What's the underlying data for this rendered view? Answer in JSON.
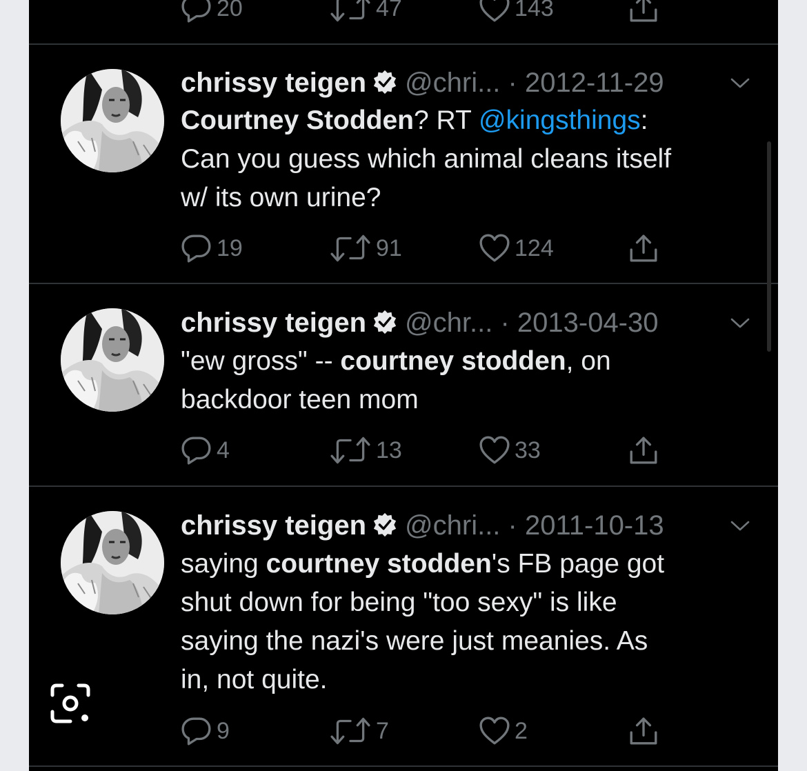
{
  "top_actions": {
    "replies": "20",
    "retweets": "47",
    "likes": "143"
  },
  "tweets": [
    {
      "name": "chrissy teigen",
      "handle": "@chri...",
      "date": "· 2012-11-29",
      "text": {
        "p1": "Courtney Stodden",
        "p2": "? RT ",
        "mention": "@kingsthings",
        "p3": ":",
        "line2": "Can you guess which animal cleans itself",
        "line3": "w/ its own urine?"
      },
      "replies": "19",
      "retweets": "91",
      "likes": "124"
    },
    {
      "name": "chrissy teigen",
      "handle": "@chr...",
      "date": "· 2013-04-30",
      "text": {
        "p1": "\"ew gross\" -- ",
        "p2": "courtney stodden",
        "p3": ", on",
        "line2": "backdoor teen mom"
      },
      "replies": "4",
      "retweets": "13",
      "likes": "33"
    },
    {
      "name": "chrissy teigen",
      "handle": "@chri...",
      "date": "· 2011-10-13",
      "text": {
        "p1": "saying ",
        "p2": "courtney stodden",
        "p3": "'s FB page got",
        "line2": "shut down for being \"too sexy\" is like",
        "line3": "saying the nazi's were just meanies. As",
        "line4": "in, not quite."
      },
      "replies": "9",
      "retweets": "7",
      "likes": "2"
    }
  ],
  "icons": {
    "reply": "reply-icon",
    "retweet": "retweet-icon",
    "like": "like-icon",
    "share": "share-icon",
    "verified": "verified-badge-icon",
    "caret": "chevron-down-icon",
    "lens": "lens-search-icon"
  },
  "colors": {
    "background": "#000000",
    "text": "#e7e9ea",
    "muted": "#71767b",
    "mention": "#1d9bf0",
    "divider": "#2f3336"
  }
}
